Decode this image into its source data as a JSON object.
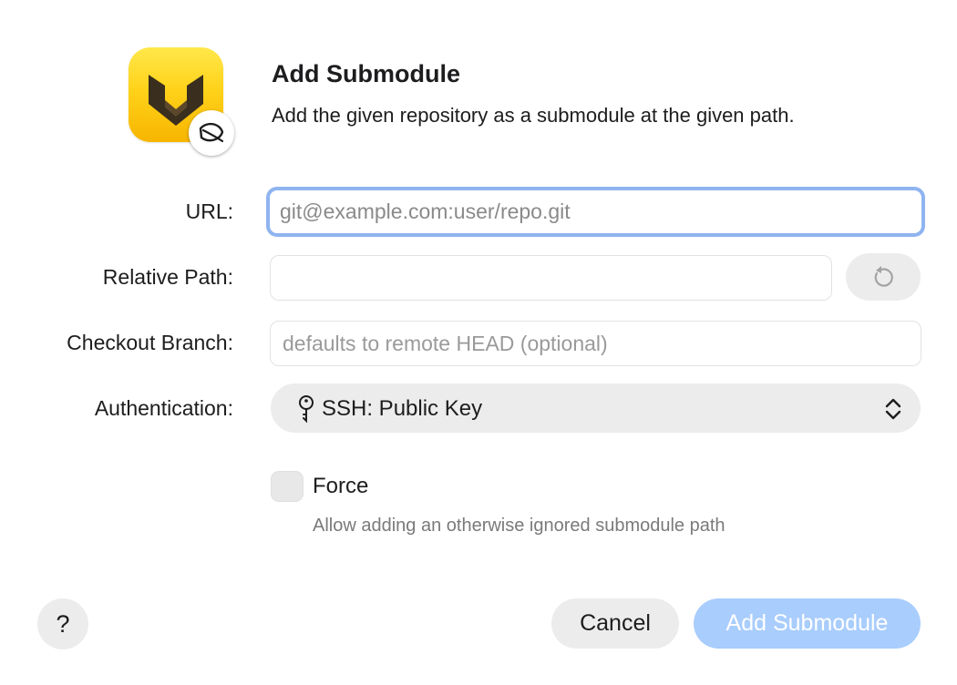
{
  "header": {
    "title": "Add Submodule",
    "subtitle": "Add the given repository as a submodule at the given path."
  },
  "form": {
    "url": {
      "label": "URL:",
      "value": "",
      "placeholder": "git@example.com:user/repo.git"
    },
    "relative_path": {
      "label": "Relative Path:",
      "value": "",
      "placeholder": ""
    },
    "checkout_branch": {
      "label": "Checkout Branch:",
      "value": "",
      "placeholder": "defaults to remote HEAD (optional)"
    },
    "authentication": {
      "label": "Authentication:",
      "selected": "SSH: Public Key"
    },
    "force": {
      "label": "Force",
      "checked": false,
      "hint": "Allow adding an otherwise ignored submodule path"
    }
  },
  "buttons": {
    "help": "?",
    "cancel": "Cancel",
    "submit": "Add Submodule"
  },
  "icons": {
    "app": "app-logo-icon",
    "badge": "leaf-badge-icon",
    "reset": "reset-arrow-icon",
    "auth": "key-icon",
    "select": "up-down-chevron-icon"
  },
  "colors": {
    "accent_focus": "#8fb4f0",
    "primary_disabled": "#a9cdfd",
    "app_icon_yellow": "#ffd21a"
  }
}
